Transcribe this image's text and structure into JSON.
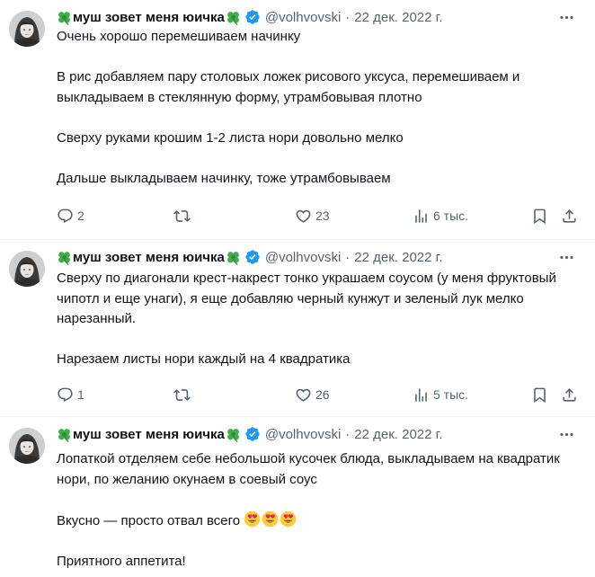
{
  "tweets": [
    {
      "author": "муш зовет меня юичка",
      "handle": "@volhvovski",
      "date": "22 дек. 2022 г.",
      "paragraphs": [
        "Очень хорошо перемешиваем начинку",
        "В рис добавляем пару столовых ложек рисового уксуса, перемешиваем и выкладываем в стеклянную форму, утрамбовывая плотно",
        "Сверху руками крошим 1-2 листа нори довольно мелко",
        "Дальше выкладываем начинку, тоже утрамбовываем"
      ],
      "replies": "2",
      "reposts": "",
      "likes": "23",
      "views": "6 тыс."
    },
    {
      "author": "муш зовет меня юичка",
      "handle": "@volhvovski",
      "date": "22 дек. 2022 г.",
      "paragraphs": [
        "Сверху по диагонали крест-накрест тонко украшаем соусом (у меня фруктовый чипотл и еще унаги), я еще добавляю черный кунжут и зеленый лук мелко нарезанный.",
        "Нарезаем листы нори каждый на 4 квадратика"
      ],
      "replies": "1",
      "reposts": "",
      "likes": "26",
      "views": "5 тыс."
    },
    {
      "author": "муш зовет меня юичка",
      "handle": "@volhvovski",
      "date": "22 дек. 2022 г.",
      "paragraphs": [
        "Лопаткой отделяем себе небольшой кусочек блюда, выкладываем на квадратик нори, по желанию окунаем в соевый соус",
        "Вкусно — просто отвал всего",
        "Приятного аппетита!"
      ],
      "emoji": [
        "heart-eyes",
        "heart-eyes",
        "heart-eyes"
      ]
    }
  ],
  "icons": {
    "name_emoji": "four-leaf-clover",
    "verified": "verified-badge",
    "more": "more-icon",
    "actions": [
      "reply-icon",
      "repost-icon",
      "like-icon",
      "views-icon",
      "bookmark-icon",
      "share-icon"
    ]
  },
  "colors": {
    "verified": "#1d9bf0",
    "secondary_text": "#536471",
    "primary_text": "#0f1419",
    "separator": "#eff3f4",
    "clover": "#2e9d3a"
  }
}
